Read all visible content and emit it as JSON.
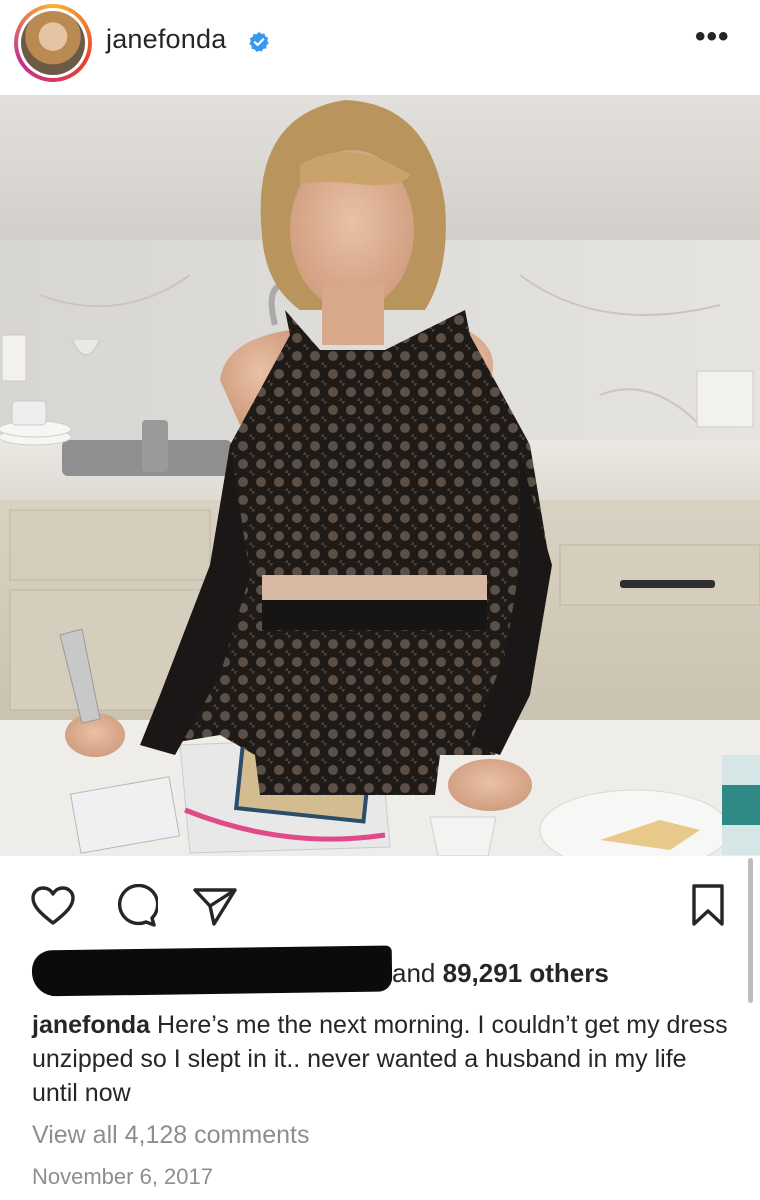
{
  "header": {
    "username": "janefonda",
    "more_label": "•••"
  },
  "post": {
    "image_alt": "Woman in black lace dress standing in a kitchen",
    "likes_suffix": "and",
    "likes_count": "89,291 others",
    "caption_user": "janefonda",
    "caption_text": "Here’s me the next morning. I couldn’t get my dress unzipped so I slept in it.. never wanted a husband in my life until now",
    "view_comments": "View all 4,128 comments",
    "date": "November 6, 2017"
  },
  "icons": {
    "like": "heart-icon",
    "comment": "comment-icon",
    "share": "share-icon",
    "save": "bookmark-icon",
    "verified": "verified-badge-icon"
  },
  "colors": {
    "verified_blue": "#3897f0",
    "text": "#262626",
    "secondary": "#8e8e8e"
  }
}
